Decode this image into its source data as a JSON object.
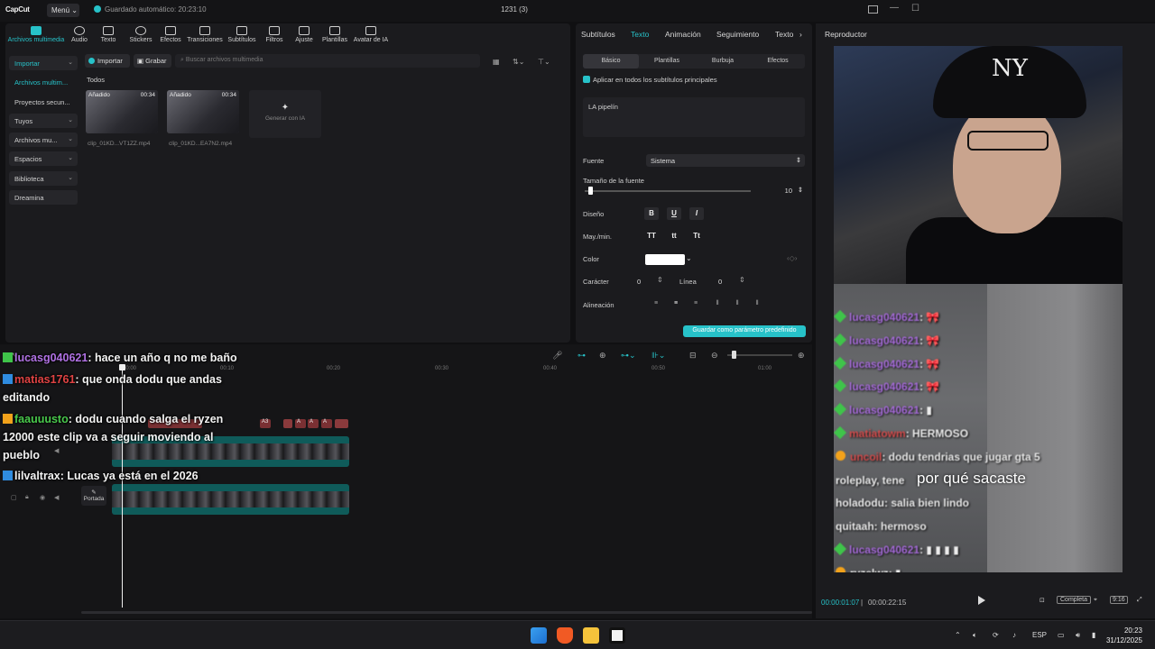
{
  "app": {
    "logo": "CapCut",
    "menu": "Menú",
    "autosave": "Guardado automático: 20:23:10",
    "project_title": "1231 (3)"
  },
  "toolbar": {
    "items": [
      "Archivos multimedia",
      "Audio",
      "Texto",
      "Stickers",
      "Efectos",
      "Transiciones",
      "Subtítulos",
      "Filtros",
      "Ajuste",
      "Plantillas",
      "Avatar de IA"
    ]
  },
  "sidenav": {
    "items": [
      "Importar",
      "Archivos multim...",
      "Proyectos secun...",
      "Tuyos",
      "Archivos mu...",
      "Espacios",
      "Biblioteca",
      "Dreamina"
    ]
  },
  "media": {
    "import_label": "Importar",
    "record_label": "Grabar",
    "search_placeholder": "Buscar archivos multimedia",
    "all_label": "Todos",
    "clips": [
      {
        "tag": "Añadido",
        "duration": "00:34",
        "name": "clip_01KD...VT1ZZ.mp4"
      },
      {
        "tag": "Añadido",
        "duration": "00:34",
        "name": "clip_01KD...EA7N2.mp4"
      }
    ],
    "generate_ai": "Generar con IA"
  },
  "props": {
    "tabs": [
      "Subtítulos",
      "Texto",
      "Animación",
      "Seguimiento",
      "Texto"
    ],
    "subtabs": [
      "Básico",
      "Plantillas",
      "Burbuja",
      "Efectos"
    ],
    "apply_all": "Aplicar en todos los subtítulos principales",
    "text_value": "LA pipelín",
    "font_label": "Fuente",
    "font_value": "Sistema",
    "size_label": "Tamaño de la fuente",
    "size_value": "10",
    "size_fraction": 0.02,
    "design_label": "Diseño",
    "style_buttons": [
      "B",
      "U",
      "I"
    ],
    "case_label": "May./min.",
    "case_buttons": [
      "TT",
      "tt",
      "Tt"
    ],
    "color_label": "Color",
    "color_value": "#ffffff",
    "char_label": "Carácter",
    "char_value": "0",
    "line_label": "Línea",
    "line_value": "0",
    "align_label": "Alineación",
    "save_preset": "Guardar como parámetro predefinido"
  },
  "player": {
    "title": "Reproductor",
    "current_time": "00:00:01:07",
    "total_time": "00:00:22:15",
    "mode": "Completa",
    "ratio": "9:16",
    "subtitle": "por qué sacaste",
    "cap_logo": "NY",
    "chat": [
      {
        "badge": "g",
        "user": "lucasg040621",
        "msg": ": 🎀",
        "color": "purple"
      },
      {
        "badge": "g",
        "user": "lucasg040621",
        "msg": ": 🎀",
        "color": "purple"
      },
      {
        "badge": "g",
        "user": "lucasg040621",
        "msg": ": 🎀",
        "color": "purple"
      },
      {
        "badge": "g",
        "user": "lucasg040621",
        "msg": ": 🎀",
        "color": "purple"
      },
      {
        "badge": "g",
        "user": "lucasg040621",
        "msg": ": ▮",
        "color": "purple"
      },
      {
        "badge": "g",
        "user": "matiatowm",
        "msg": ": HERMOSO",
        "color": "red"
      },
      {
        "badge": "o",
        "user": "uncoil",
        "msg": ": dodu tendrias que jugar gta 5",
        "color": "red"
      },
      {
        "badge": "",
        "user": "roleplay, tene",
        "msg": "",
        "color": "white"
      },
      {
        "badge": "",
        "user": "holadodu",
        "msg": ": salia bien lindo",
        "color": "white"
      },
      {
        "badge": "",
        "user": "quitaah",
        "msg": ": hermoso",
        "color": "white"
      },
      {
        "badge": "g",
        "user": "lucasg040621",
        "msg": ": ▮ ▮ ▮ ▮",
        "color": "purple"
      },
      {
        "badge": "o",
        "user": "ryzelwz",
        "msg": ": ▮",
        "color": "white"
      }
    ]
  },
  "timeline": {
    "ticks": [
      "00:00",
      "00:10",
      "00:20",
      "00:30",
      "00:40",
      "00:50",
      "01:00"
    ],
    "text_clips": [
      "A3",
      "A",
      "A",
      "A"
    ],
    "cover_label": "Portada"
  },
  "overlay_chat": [
    {
      "user": "lucasg040621",
      "msg": ": hace un año q no me baño",
      "color": "purple"
    },
    {
      "user": "matias1761",
      "msg": ": que onda dodu que andas",
      "color": "red"
    },
    {
      "user": "",
      "msg": "editando",
      "color": "white"
    },
    {
      "user": "faauuusto",
      "msg": ": dodu cuando salga el ryzen",
      "color": "green"
    },
    {
      "user": "",
      "msg": "12000 este clip va a seguir moviendo al",
      "color": "white"
    },
    {
      "user": "",
      "msg": "pueblo",
      "color": "white"
    },
    {
      "user": "lilvaltrax",
      "msg": ": Lucas ya está en el 2026",
      "color": "white"
    }
  ],
  "taskbar": {
    "language": "ESP",
    "time": "20:23",
    "date": "31/12/2025"
  }
}
